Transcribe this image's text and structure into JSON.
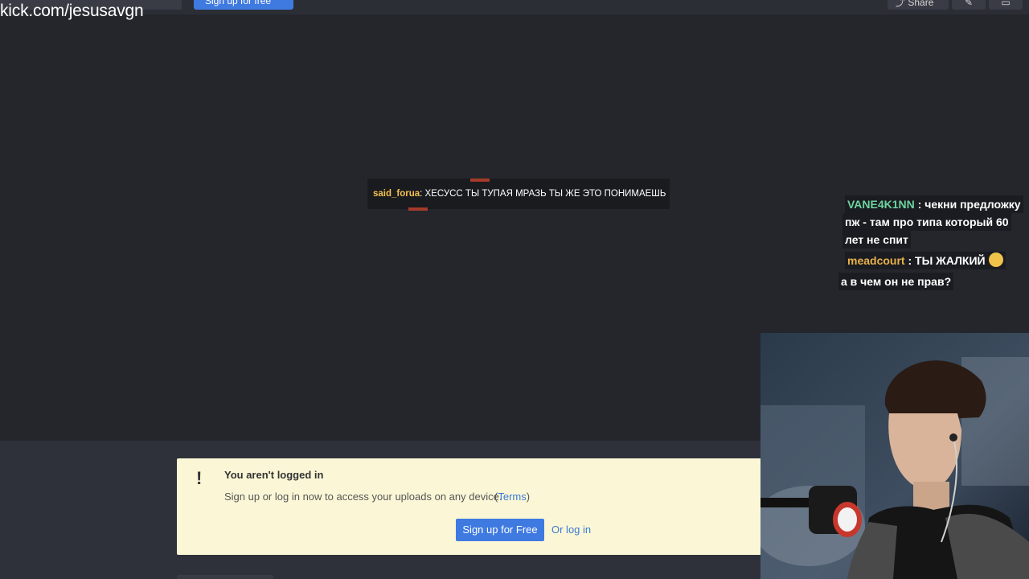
{
  "watermark": "kick.com/jesusavgn",
  "topbar": {
    "signup_label": "Sign up for free",
    "share_label": "Share"
  },
  "center_chat": {
    "username": "said_forua",
    "message": ": ХЕСУСС ТЫ ТУПАЯ МРАЗЬ ТЫ ЖЕ ЭТО ПОНИМАЕШЬ"
  },
  "side_chat": [
    {
      "user": "VANE4K1NN",
      "text": " : чекни предложку"
    },
    {
      "user": "",
      "text": "пж - там про типа который 60"
    },
    {
      "user": "",
      "text": "лет не спит"
    },
    {
      "user": "meadcourt",
      "text": " : ТЫ ЖАЛКИЙ"
    },
    {
      "user": "",
      "text": "а в чем он не прав?"
    }
  ],
  "notice": {
    "icon": "!",
    "title": "You aren't logged in",
    "message": "Sign up or log in now to access your uploads on any device.",
    "terms_open": "(",
    "terms_label": "Terms",
    "terms_close": ")",
    "signup_label": "Sign up for Free",
    "login_label": "Or log in"
  },
  "colors": {
    "accent": "#3f7ae0",
    "notice_bg": "#fbf7d6",
    "chat_user_green": "#6dd3a0",
    "chat_user_gold": "#e8b24a"
  }
}
